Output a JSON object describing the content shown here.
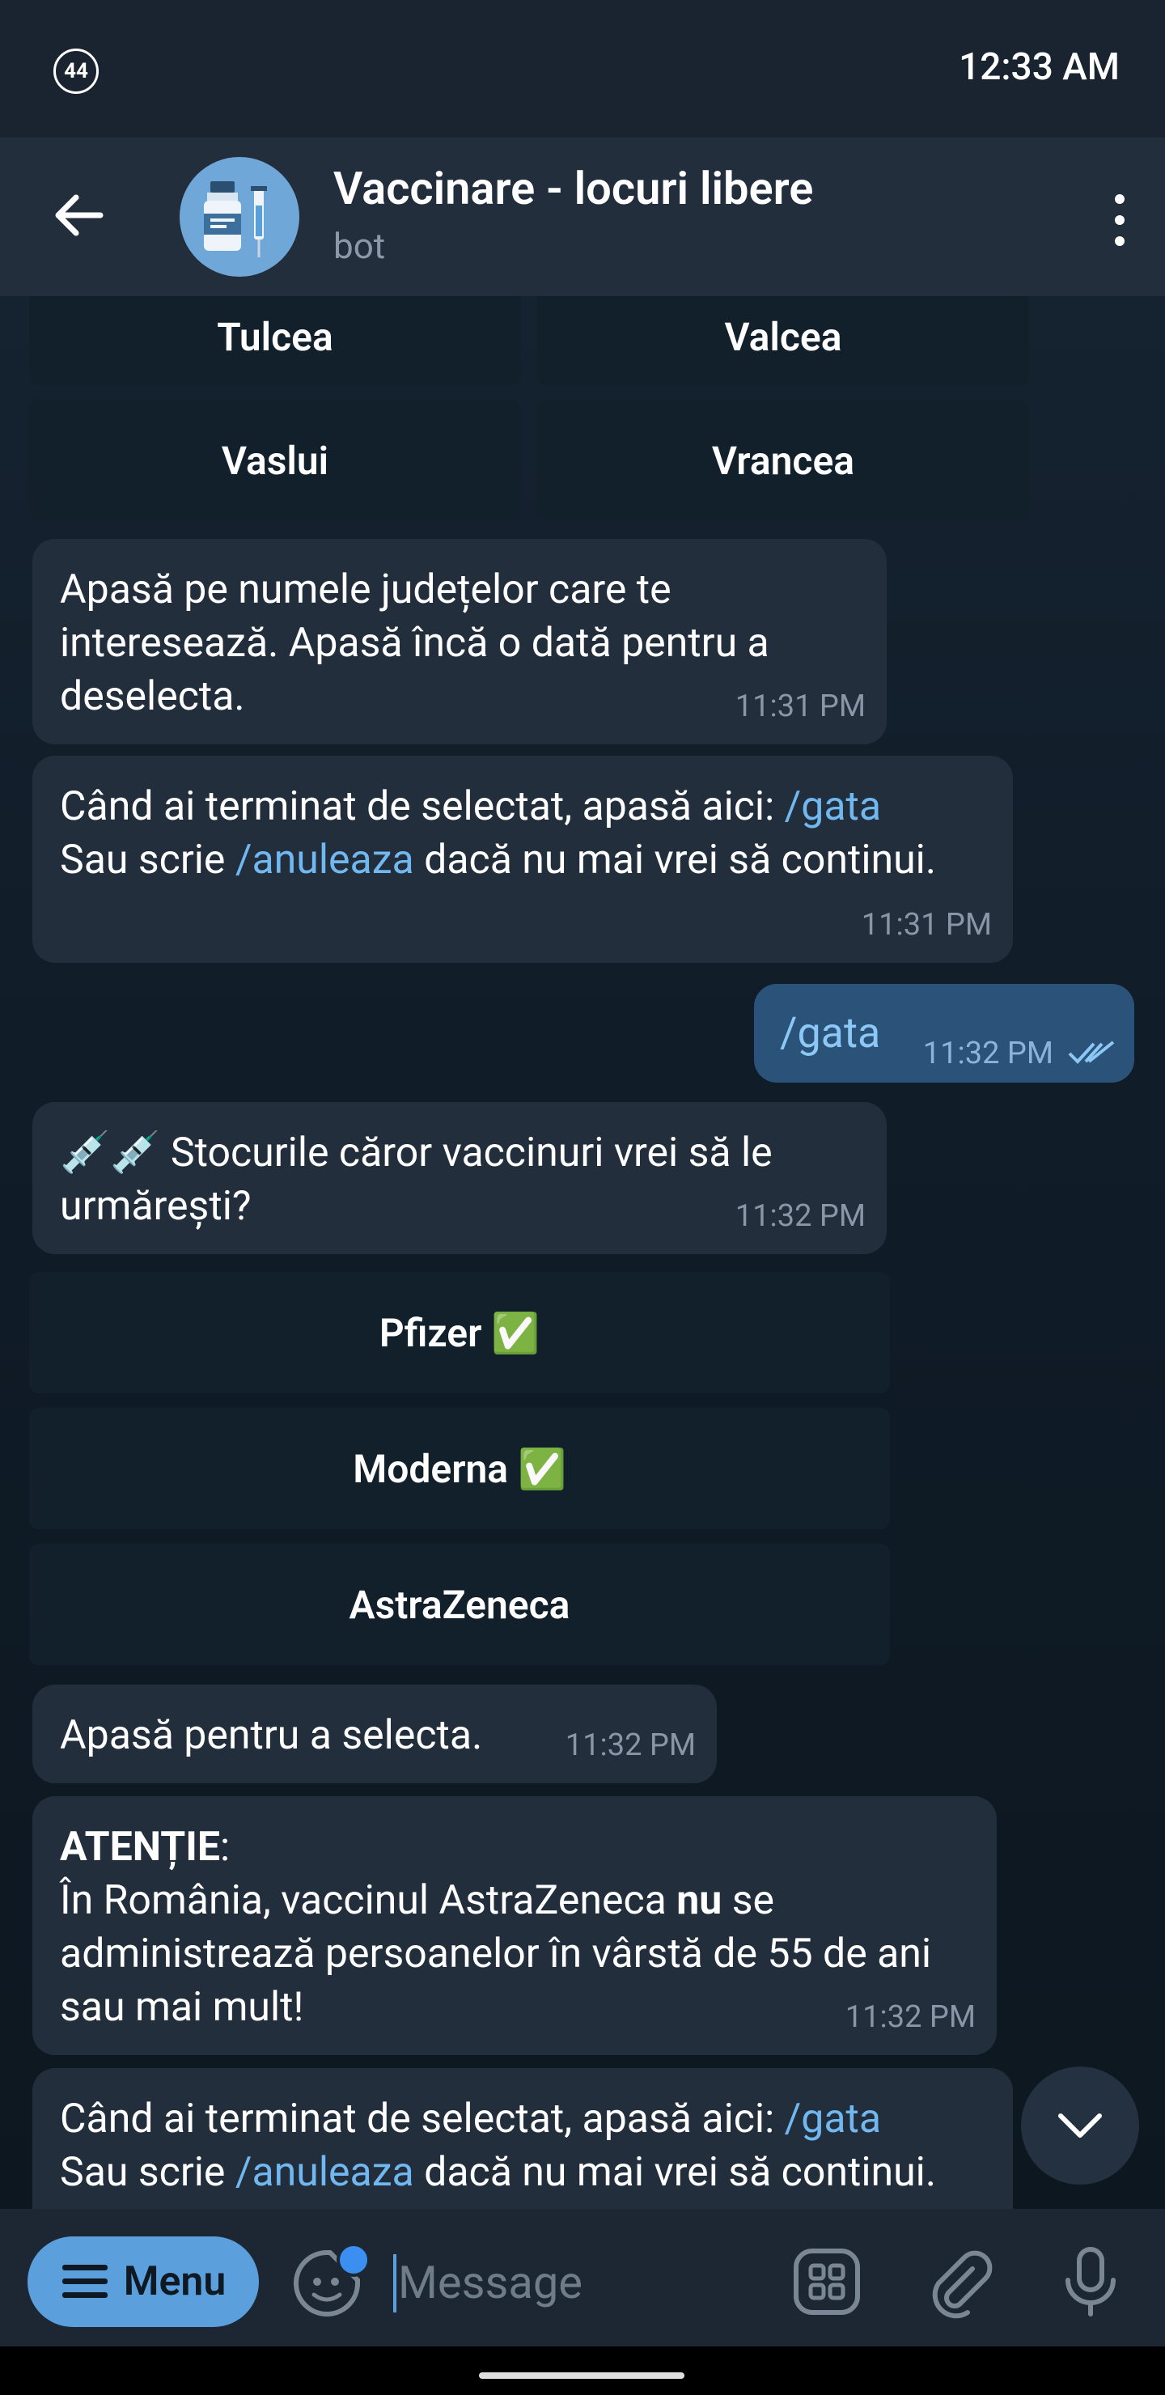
{
  "status": {
    "badge": "44",
    "time": "12:33 AM"
  },
  "header": {
    "title": "Vaccinare - locuri libere",
    "subtitle": "bot"
  },
  "counties": [
    "Tulcea",
    "Valcea",
    "Vaslui",
    "Vrancea"
  ],
  "messages": {
    "m1": {
      "text": "Apasă pe numele județelor care te interesează. Apasă încă o dată pentru a deselecta.",
      "time": "11:31 PM"
    },
    "m2": {
      "l1": "Când ai terminat de selectat, apasă aici: ",
      "cmd1": "/gata",
      "l2": "Sau scrie ",
      "cmd2": "/anuleaza",
      "l3": " dacă nu mai vrei să continui.",
      "time": "11:31 PM"
    },
    "out": {
      "text": "/gata",
      "time": "11:32 PM"
    },
    "m3": {
      "emoji": "💉💉",
      "text": " Stocurile căror vaccinuri vrei să le urmărești?",
      "time": "11:32 PM"
    },
    "vaccines": [
      "Pfizer ✅",
      "Moderna ✅",
      "AstraZeneca"
    ],
    "m4": {
      "text": "Apasă pentru a selecta.",
      "time": "11:32 PM"
    },
    "m5": {
      "bold": "ATENȚIE",
      "colon": ":",
      "a": "În România, vaccinul AstraZeneca ",
      "b": "nu",
      "c": " se administrează persoanelor în vârstă de 55 de ani sau mai mult!",
      "time": "11:32 PM"
    },
    "m6": {
      "l1": "Când ai terminat de selectat, apasă aici: ",
      "cmd1": "/gata",
      "l2": "Sau scrie ",
      "cmd2": "/anuleaza",
      "l3": " dacă nu mai vrei să continui."
    }
  },
  "input": {
    "menu": "Menu",
    "placeholder": "Message"
  }
}
